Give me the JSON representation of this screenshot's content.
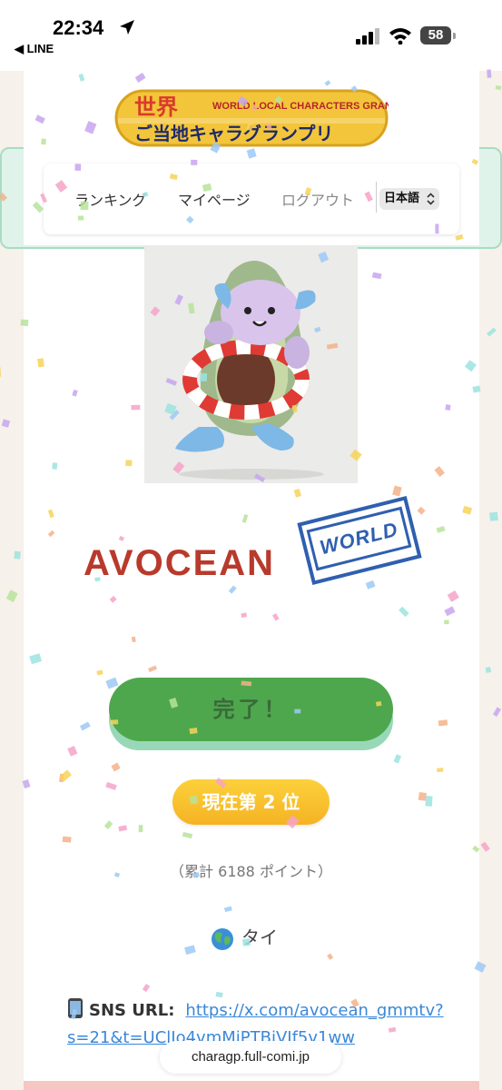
{
  "status_bar": {
    "time": "22:34",
    "back_app": "◀ LINE",
    "battery": "58"
  },
  "header": {
    "logo_title": "世界",
    "logo_subtitle": "WORLD LOCAL CHARACTERS GRANDPRIX",
    "logo_main": "ご当地キャラグランプリ",
    "nav": {
      "ranking": "ランキング",
      "mypage": "マイページ",
      "logout": "ログアウト",
      "language": "日本語"
    }
  },
  "character": {
    "name": "AVOCEAN",
    "stamp": "WORLD"
  },
  "actions": {
    "done_label": "完了！"
  },
  "rank": {
    "label": "現在第 2 位",
    "points_text": "（累計 6188 ポイント）"
  },
  "country": {
    "name": "タイ"
  },
  "sns": {
    "label": "SNS URL:",
    "url": "https://x.com/avocean_gmmtv?s=21&t=UClIo4vmMiPTBiVIf5v1ww"
  },
  "browser": {
    "domain": "charagp.full-comi.jp"
  },
  "colors": {
    "accent_green": "#4ea74c",
    "name_red": "#b83a2c",
    "stamp_blue": "#2f5fb0",
    "badge_gold": "#f5b324",
    "link_blue": "#3a88d8"
  }
}
